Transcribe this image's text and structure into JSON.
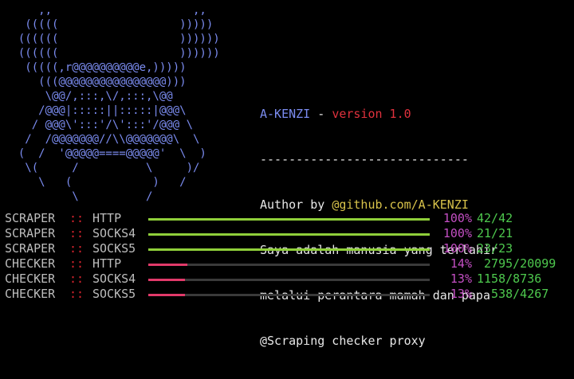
{
  "ascii_art": "     ,,                     ,,\n   (((((                  )))))\n  ((((((                  ))))))\n  ((((((                  ))))))\n   (((((,r@@@@@@@@@@e,)))))\n     (((@@@@@@@@@@@@@@@@)))\n      \\@@/,:::,\\/,:::,\\@@\n     /@@@|:::::||:::::|@@@\\\n    / @@@\\':::'/\\':::'/@@@ \\\n   /  /@@@@@@@//\\\\@@@@@@@\\  \\\n  (  /  '@@@@@====@@@@@'  \\  )\n   \\(     /          \\     )/\n     \\   (            )   /\n          \\          /",
  "info": {
    "name": "A-KENZI",
    "separator": " - ",
    "version": "version 1.0",
    "divider": "-----------------------------",
    "author_prefix": "Author by ",
    "author_link": "@github.com/A-KENZI",
    "line1": "Saya adalah manusia yang terlahir",
    "line2": "melalui perantara mamah dan papa",
    "line3": "@Scraping checker proxy"
  },
  "status_rows": [
    {
      "type": "SCRAPER",
      "sep": "::",
      "proto": "HTTP",
      "progress": 1.0,
      "pct": "100%",
      "count": "42/42",
      "bar_color": "#8fcf3a"
    },
    {
      "type": "SCRAPER",
      "sep": "::",
      "proto": "SOCKS4",
      "progress": 1.0,
      "pct": "100%",
      "count": "21/21",
      "bar_color": "#8fcf3a"
    },
    {
      "type": "SCRAPER",
      "sep": "::",
      "proto": "SOCKS5",
      "progress": 1.0,
      "pct": "100%",
      "count": "23/23",
      "bar_color": "#8fcf3a"
    },
    {
      "type": "CHECKER",
      "sep": "::",
      "proto": "HTTP",
      "progress": 0.14,
      "pct": "14%",
      "count": " 2795/20099",
      "bar_color": "#e23a6a"
    },
    {
      "type": "CHECKER",
      "sep": "::",
      "proto": "SOCKS4",
      "progress": 0.13,
      "pct": "13%",
      "count": "1158/8736",
      "bar_color": "#e23a6a"
    },
    {
      "type": "CHECKER",
      "sep": "::",
      "proto": "SOCKS5",
      "progress": 0.13,
      "pct": "13%",
      "count": "  538/4267",
      "bar_color": "#e23a6a"
    }
  ]
}
